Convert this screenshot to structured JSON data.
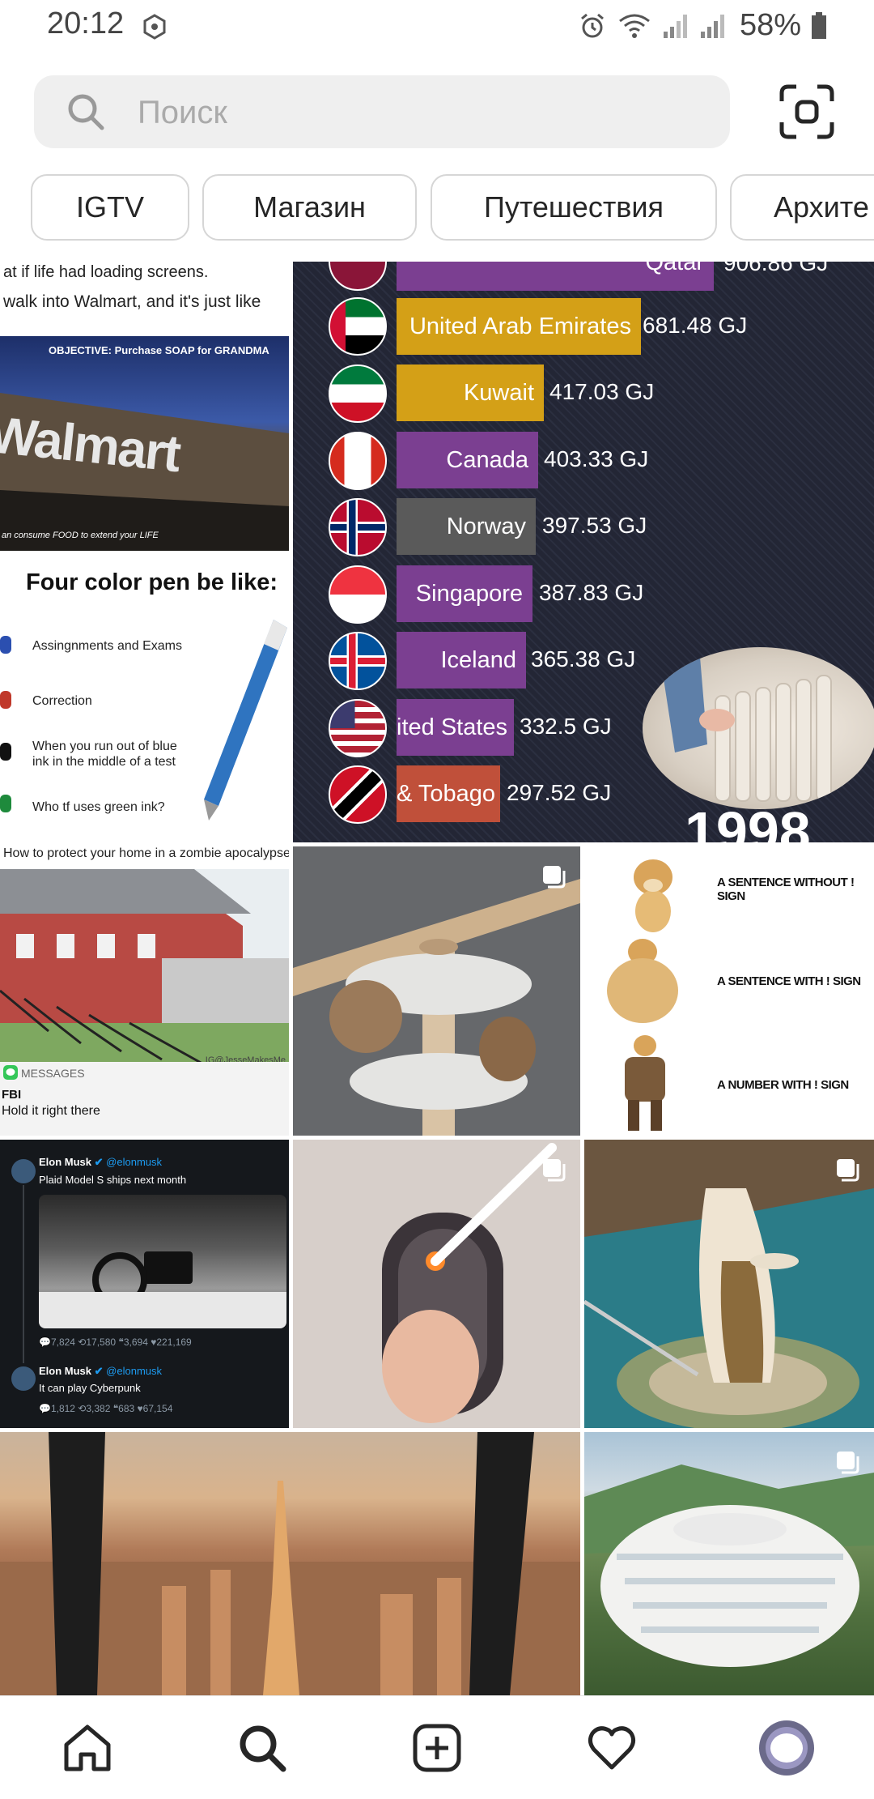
{
  "status_bar": {
    "time": "20:12",
    "battery": "58%"
  },
  "search": {
    "placeholder": "Поиск"
  },
  "chips": [
    {
      "label": "IGTV"
    },
    {
      "label": "Магазин"
    },
    {
      "label": "Путешествия"
    },
    {
      "label": "Архите"
    }
  ],
  "walmart_meme": {
    "caption_line1": "at if life had loading screens.",
    "caption_line2": "walk into Walmart, and it's just like",
    "objective": "OBJECTIVE: Purchase SOAP for GRANDMA",
    "logo_text": "Walmart",
    "footer": "an consume FOOD to extend your LIFE"
  },
  "pen_meme": {
    "title": "Four color pen be like:",
    "items": [
      "Assingnments and Exams",
      "Correction",
      "When you run out of blue ink in the middle of a test",
      "Who tf uses green ink?"
    ]
  },
  "chart_post": {
    "year": "1998",
    "colors": {
      "gold": "#d4a017",
      "purple": "#7b3f91",
      "gray": "#5a5a5a",
      "red": "#c0503a"
    },
    "rows": [
      {
        "country": "Qatar",
        "value": "906.86 GJ"
      },
      {
        "country": "United Arab Emirates",
        "value": "681.48 GJ"
      },
      {
        "country": "Kuwait",
        "value": "417.03 GJ"
      },
      {
        "country": "Canada",
        "value": "403.33 GJ"
      },
      {
        "country": "Norway",
        "value": "397.53 GJ"
      },
      {
        "country": "Singapore",
        "value": "387.83 GJ"
      },
      {
        "country": "Iceland",
        "value": "365.38 GJ"
      },
      {
        "country": "ited States",
        "value": "332.5 GJ"
      },
      {
        "country": "& Tobago",
        "value": "297.52 GJ"
      }
    ]
  },
  "zombie_meme": {
    "caption": "How to protect your home in a zombie apocalypse",
    "watermark": "IG@JesseMakesMe",
    "messages_label": "MESSAGES",
    "sender": "FBI",
    "message": "Hold it right there"
  },
  "doge_meme": {
    "lines": [
      "A SENTENCE WITHOUT ! SIGN",
      "A SENTENCE WITH ! SIGN",
      "A NUMBER WITH ! SIGN"
    ]
  },
  "musk_tweets": {
    "name": "Elon Musk",
    "handle": "@elonmusk",
    "tweet1": "Plaid Model S ships next month",
    "stats1": "💬7,824  ⟲17,580  ❝3,694  ♥221,169",
    "tweet2": "It can play Cyberpunk",
    "stats2": "💬1,812  ⟲3,382  ❝683  ♥67,154"
  }
}
